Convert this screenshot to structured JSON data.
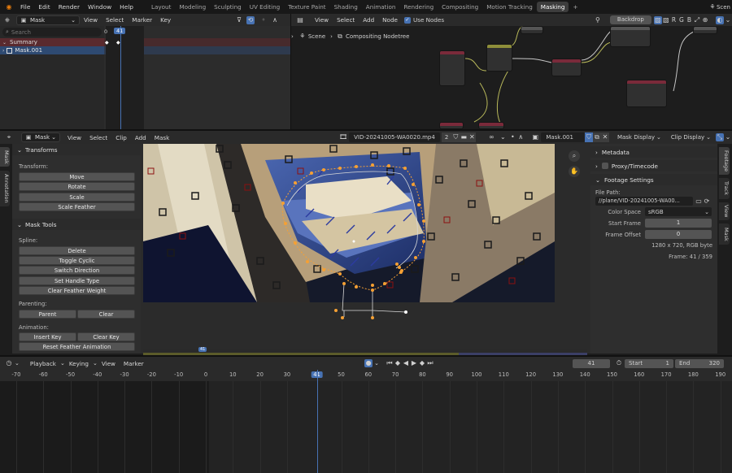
{
  "menu": {
    "items": [
      "File",
      "Edit",
      "Render",
      "Window",
      "Help"
    ]
  },
  "workspaces": [
    "Layout",
    "Modeling",
    "Sculpting",
    "UV Editing",
    "Texture Paint",
    "Shading",
    "Animation",
    "Rendering",
    "Compositing",
    "Motion Tracking",
    "Masking"
  ],
  "active_workspace": "Masking",
  "scene_label": "Scen",
  "dopesheet": {
    "mode": "Mask",
    "menus": [
      "View",
      "Select",
      "Marker",
      "Key"
    ],
    "search_placeholder": "Search",
    "frame_start_label": "0",
    "current_frame": "41",
    "summary": "Summary",
    "mask_item": "Mask.001"
  },
  "node_editor": {
    "menus": [
      "View",
      "Select",
      "Add",
      "Node"
    ],
    "use_nodes": "Use Nodes",
    "backdrop": "Backdrop",
    "channels": [
      "R",
      "G",
      "B"
    ],
    "breadcrumb_scene": "Scene",
    "breadcrumb_tree": "Compositing Nodetree"
  },
  "clip_editor": {
    "mode": "Mask",
    "menus": [
      "View",
      "Select",
      "Clip",
      "Add",
      "Mask"
    ],
    "clip_name": "VID-20241005-WA0020.mp4",
    "users": "2",
    "mask_name": "Mask.001",
    "mask_display": "Mask Display",
    "clip_display": "Clip Display"
  },
  "toolbar": {
    "transforms_title": "Transforms",
    "transform_label": "Transform:",
    "transform_buttons": [
      "Move",
      "Rotate",
      "Scale",
      "Scale Feather"
    ],
    "mask_tools_title": "Mask Tools",
    "spline_label": "Spline:",
    "spline_buttons": [
      "Delete",
      "Toggle Cyclic",
      "Switch Direction",
      "Set Handle Type",
      "Clear Feather Weight"
    ],
    "parenting_label": "Parenting:",
    "parent_btn": "Parent",
    "clear_btn": "Clear",
    "animation_label": "Animation:",
    "insert_key": "Insert Key",
    "clear_key": "Clear Key",
    "reset_feather": "Reset Feather Animation",
    "side_tabs": [
      "Mask",
      "Annotation"
    ]
  },
  "sidebar": {
    "metadata": "Metadata",
    "proxy": "Proxy/Timecode",
    "footage": "Footage Settings",
    "file_path_label": "File Path:",
    "file_path": "//plane/VID-20241005-WA00...",
    "color_space_label": "Color Space",
    "color_space": "sRGB",
    "start_frame_label": "Start Frame",
    "start_frame": "1",
    "frame_offset_label": "Frame Offset",
    "frame_offset": "0",
    "resolution": "1280 x 720, RGB byte",
    "frame_info": "Frame: 41 / 359",
    "tabs": [
      "Footage",
      "Track",
      "View",
      "Mask"
    ]
  },
  "scrubber": {
    "current": "41"
  },
  "timeline": {
    "menus": [
      "Playback",
      "Keying",
      "View",
      "Marker"
    ],
    "current_frame": "41",
    "start_label": "Start",
    "start": "1",
    "end_label": "End",
    "end": "320",
    "ticks": [
      "-70",
      "-60",
      "-50",
      "-40",
      "-30",
      "-20",
      "-10",
      "0",
      "10",
      "20",
      "30",
      "41",
      "50",
      "60",
      "70",
      "80",
      "90",
      "100",
      "110",
      "120",
      "130",
      "140",
      "150",
      "160",
      "170",
      "180",
      "190"
    ]
  },
  "colors": {
    "accent": "#4772b3",
    "mask_orange": "#f5a034",
    "playhead": "#4772b3"
  }
}
